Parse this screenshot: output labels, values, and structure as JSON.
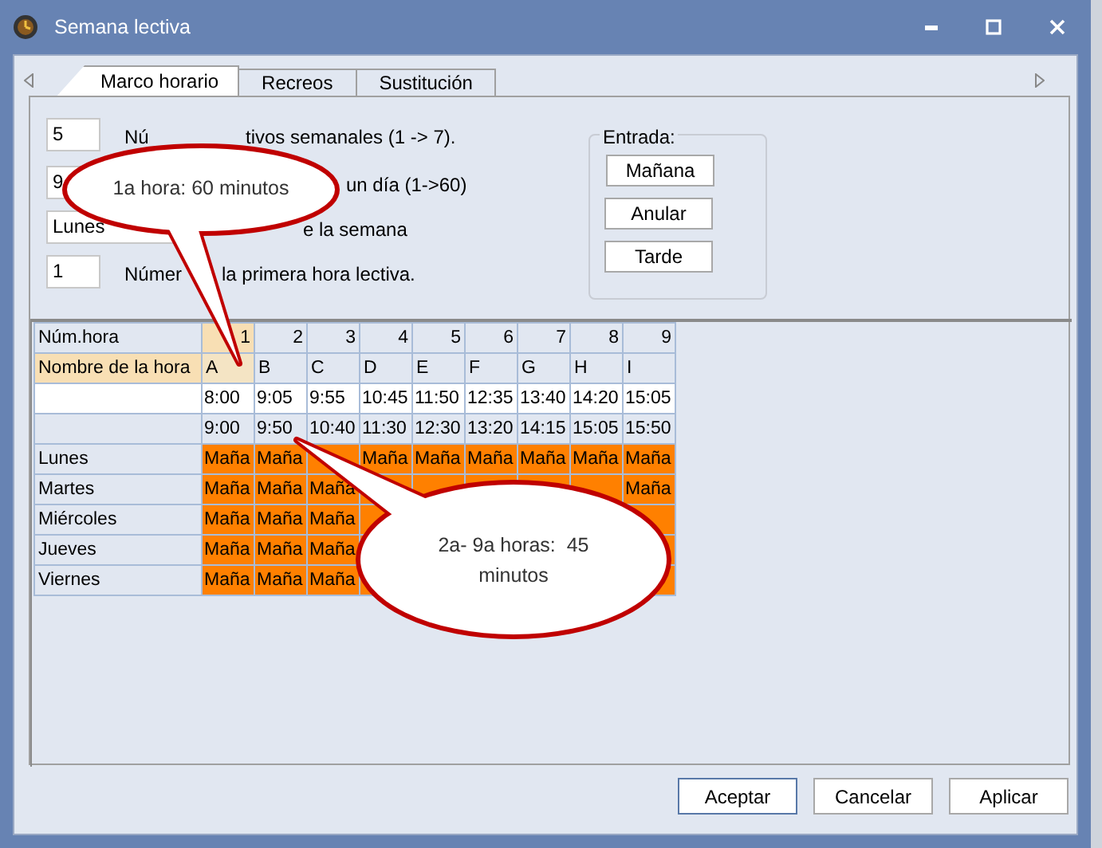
{
  "window": {
    "title": "Semana lectiva"
  },
  "tabs": [
    {
      "label": "Marco horario",
      "selected": true
    },
    {
      "label": "Recreos",
      "selected": false
    },
    {
      "label": "Sustitución",
      "selected": false
    }
  ],
  "settings": [
    {
      "value": "5",
      "label_parts": [
        "Nú",
        "tivos semanales (1 -> 7)."
      ]
    },
    {
      "value": "9",
      "label_parts": [
        "un día (1->60)"
      ]
    },
    {
      "value": "Lunes",
      "label_parts": [
        "e la semana"
      ]
    },
    {
      "value": "1",
      "label_parts": [
        "Númer",
        "la primera hora lectiva."
      ]
    }
  ],
  "entrada": {
    "legend": "Entrada:",
    "buttons": [
      "Mañana",
      "Anular",
      "Tarde"
    ]
  },
  "grid": {
    "row_labels": [
      "Núm.hora",
      "Nombre de la hora"
    ],
    "hours": [
      {
        "num": "1",
        "name": "A",
        "start": "8:00",
        "end": "9:00",
        "selected": true
      },
      {
        "num": "2",
        "name": "B",
        "start": "9:05",
        "end": "9:50",
        "selected": false
      },
      {
        "num": "3",
        "name": "C",
        "start": "9:55",
        "end": "10:40",
        "selected": false
      },
      {
        "num": "4",
        "name": "D",
        "start": "10:45",
        "end": "11:30",
        "selected": false
      },
      {
        "num": "5",
        "name": "E",
        "start": "11:50",
        "end": "12:30",
        "selected": false
      },
      {
        "num": "6",
        "name": "F",
        "start": "12:35",
        "end": "13:20",
        "selected": false
      },
      {
        "num": "7",
        "name": "G",
        "start": "13:40",
        "end": "14:15",
        "selected": false
      },
      {
        "num": "8",
        "name": "H",
        "start": "14:20",
        "end": "15:05",
        "selected": false
      },
      {
        "num": "9",
        "name": "I",
        "start": "15:05",
        "end": "15:50",
        "selected": false
      }
    ],
    "days": [
      {
        "name": "Lunes",
        "cells": [
          "Maña",
          "Maña",
          null,
          "Maña",
          "Maña",
          "Maña",
          "Maña",
          "Maña",
          "Maña"
        ]
      },
      {
        "name": "Martes",
        "cells": [
          "Maña",
          "Maña",
          "Maña",
          null,
          null,
          null,
          null,
          null,
          "Maña"
        ]
      },
      {
        "name": "Miércoles",
        "cells": [
          "Maña",
          "Maña",
          "Maña",
          null,
          null,
          null,
          null,
          null,
          null
        ]
      },
      {
        "name": "Jueves",
        "cells": [
          "Maña",
          "Maña",
          "Maña",
          null,
          null,
          null,
          null,
          null,
          null
        ]
      },
      {
        "name": "Viernes",
        "cells": [
          "Maña",
          "Maña",
          "Maña",
          null,
          null,
          null,
          null,
          null,
          null
        ]
      }
    ]
  },
  "callouts": [
    {
      "text": "1a hora: 60 minutos"
    },
    {
      "text": "2a- 9a horas:  45 minutos"
    }
  ],
  "buttons": [
    {
      "label": "Aceptar",
      "default": true
    },
    {
      "label": "Cancelar",
      "default": false
    },
    {
      "label": "Aplicar",
      "default": false
    }
  ]
}
